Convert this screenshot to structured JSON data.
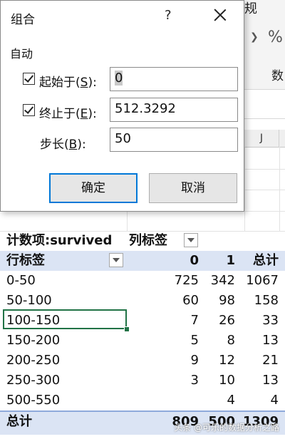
{
  "ribbon": {
    "top_partial": "规",
    "percent_icon": "%",
    "currency_icon": "❯",
    "number_partial": "数"
  },
  "sheet": {
    "column_j": "J"
  },
  "dialog": {
    "title": "组合",
    "help": "?",
    "group_label": "自动",
    "start": {
      "label_prefix": "起始于(",
      "mnemonic": "S",
      "label_suffix": "):",
      "value": "0"
    },
    "end": {
      "label_prefix": "终止于(",
      "mnemonic": "E",
      "label_suffix": "):",
      "value": "512.3292"
    },
    "step": {
      "label_prefix": "步长(",
      "mnemonic": "B",
      "label_suffix": "):",
      "value": "50"
    },
    "ok_label": "确定",
    "cancel_label": "取消"
  },
  "pivot": {
    "value_field": "计数项:survived",
    "column_labels": "列标签",
    "row_labels": "行标签",
    "columns": [
      "0",
      "1",
      "总计"
    ],
    "rows": [
      {
        "label": "0-50",
        "v0": "725",
        "v1": "342",
        "total": "1067"
      },
      {
        "label": "50-100",
        "v0": "60",
        "v1": "98",
        "total": "158"
      },
      {
        "label": "100-150",
        "v0": "7",
        "v1": "26",
        "total": "33"
      },
      {
        "label": "150-200",
        "v0": "5",
        "v1": "8",
        "total": "13"
      },
      {
        "label": "200-250",
        "v0": "9",
        "v1": "12",
        "total": "21"
      },
      {
        "label": "250-300",
        "v0": "3",
        "v1": "10",
        "total": "13"
      },
      {
        "label": "500-550",
        "v0": "",
        "v1": "4",
        "total": "4"
      }
    ],
    "grand_total": {
      "label": "总计",
      "v0": "809",
      "v1": "500",
      "total": "1309"
    }
  },
  "watermark": "头条 @可乐的数据分析之路"
}
